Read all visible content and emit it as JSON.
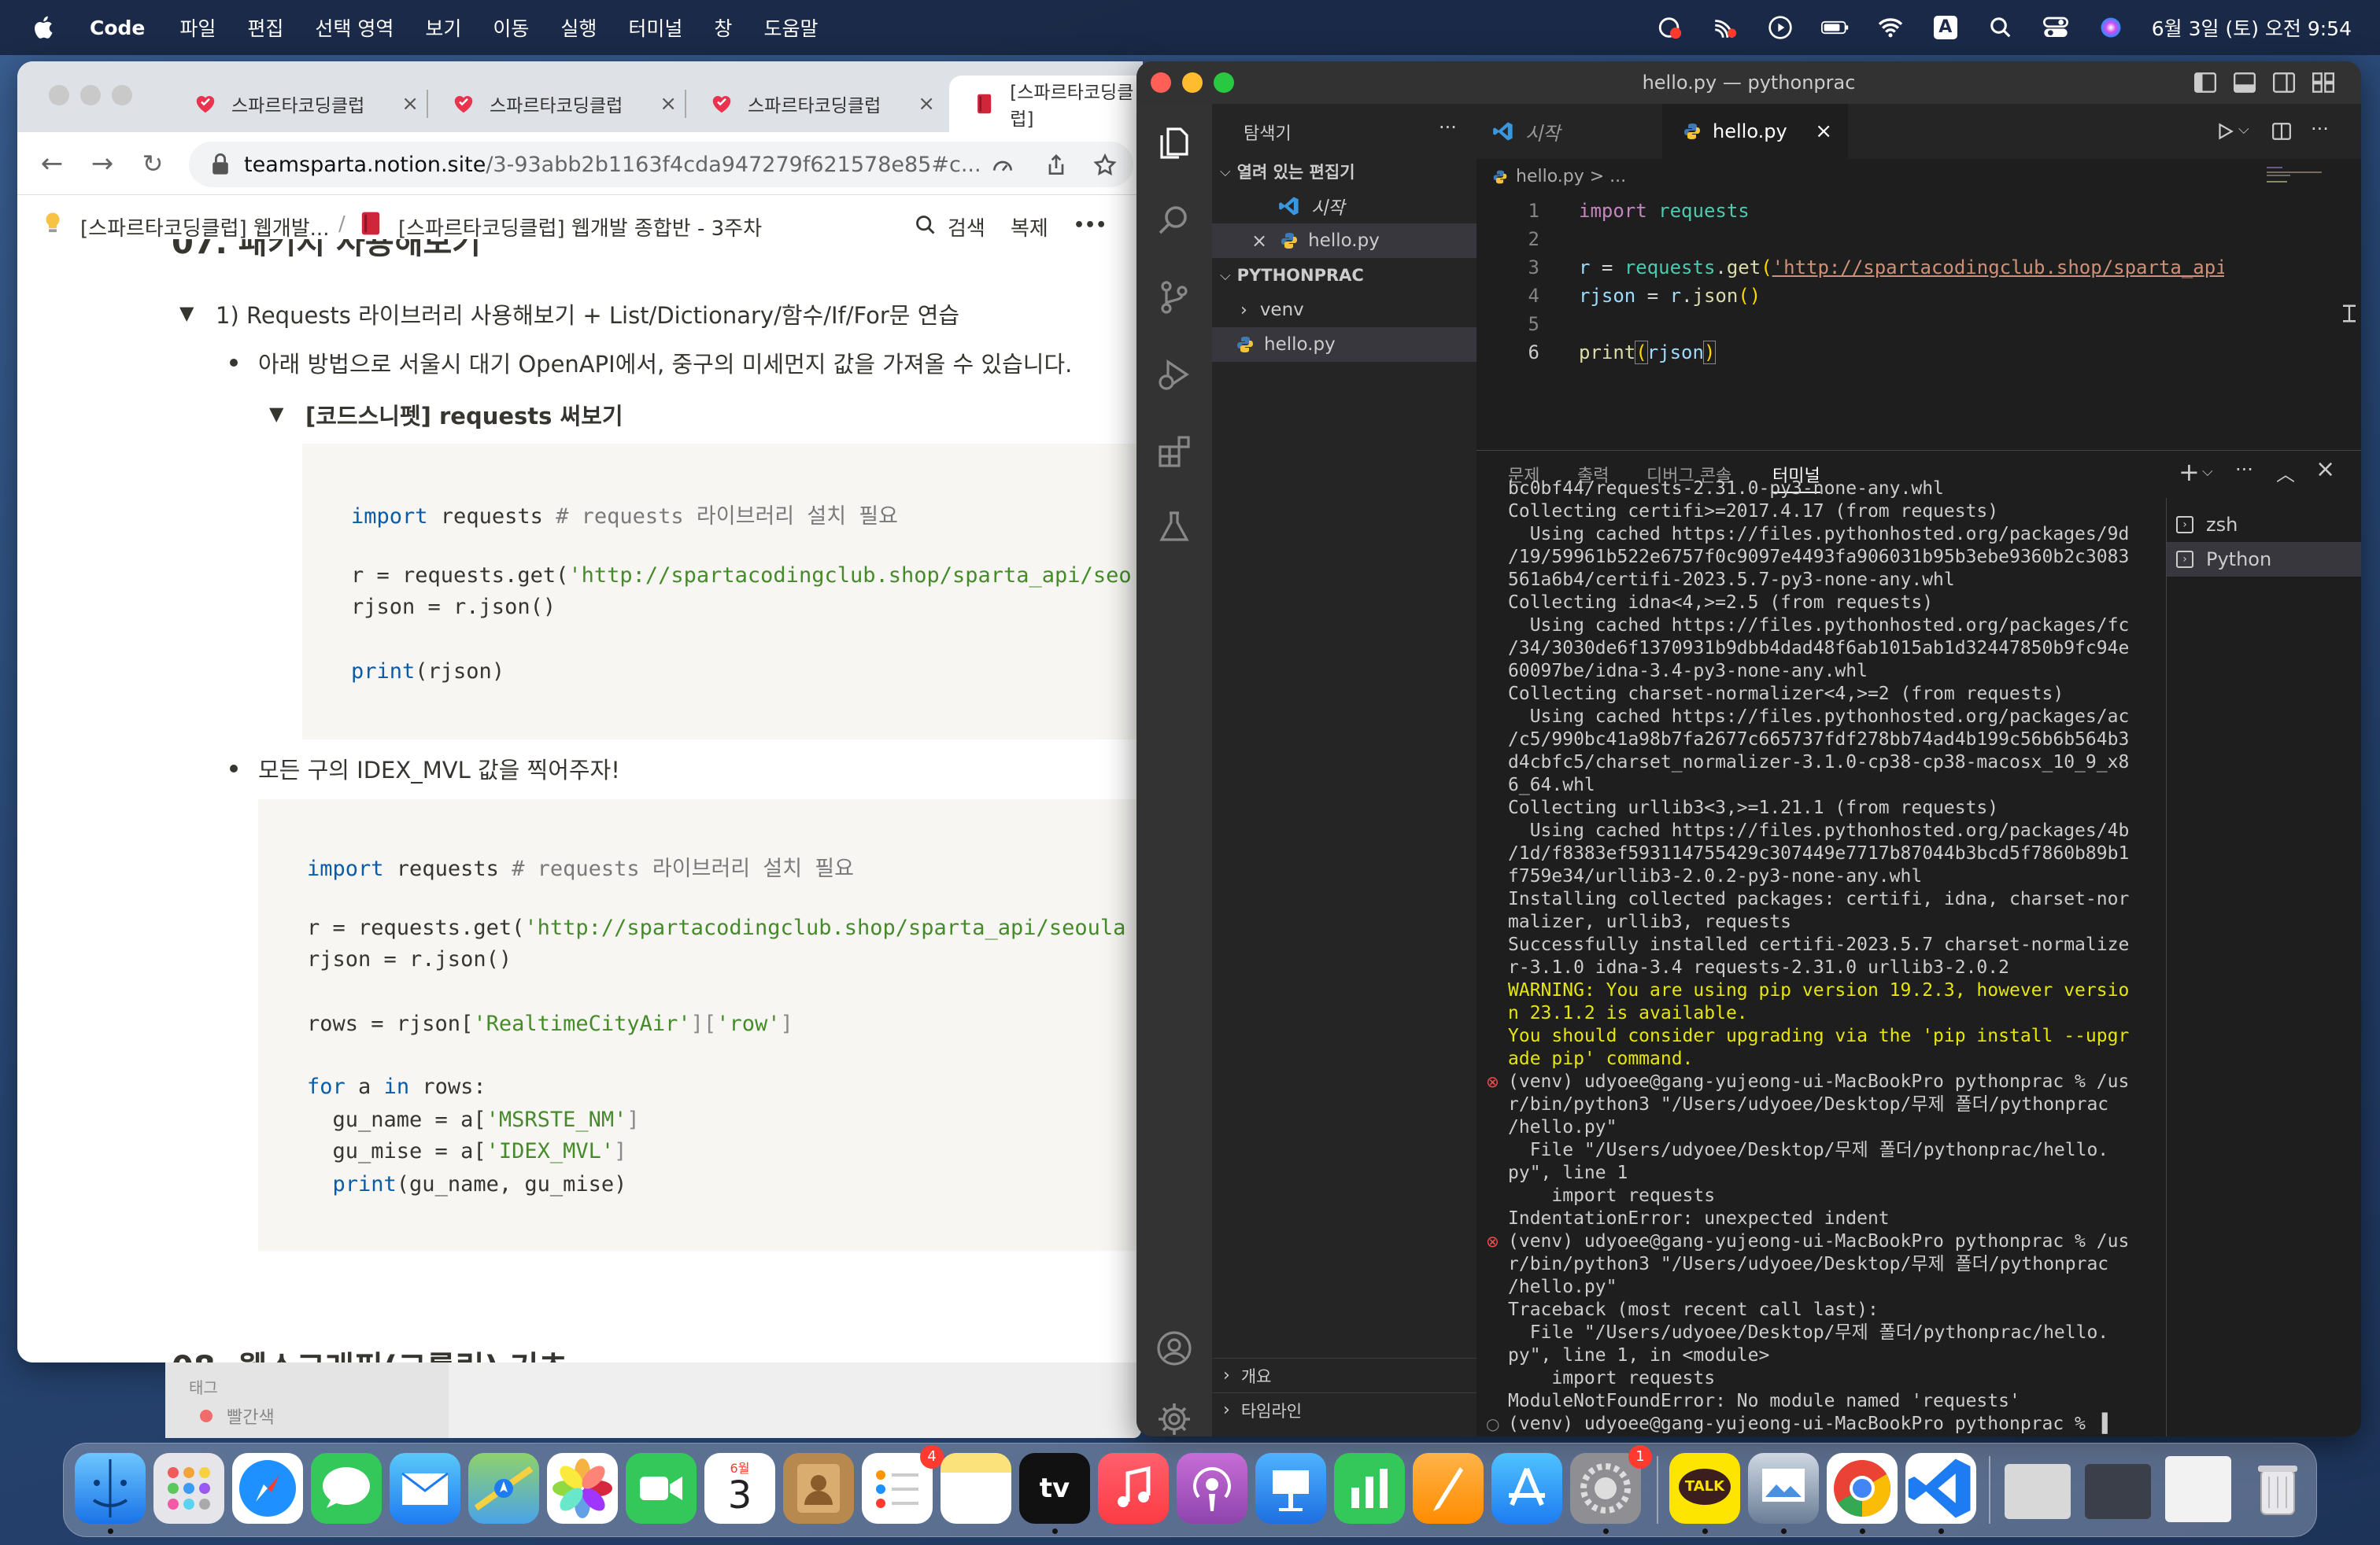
{
  "menubar": {
    "app": "Code",
    "items": [
      "파일",
      "편집",
      "선택 영역",
      "보기",
      "이동",
      "실행",
      "터미널",
      "창",
      "도움말"
    ],
    "clock": "6월 3일 (토) 오전 9:54",
    "input_indicator": "A"
  },
  "browser": {
    "tabs": [
      {
        "label": "스파르타코딩클럽"
      },
      {
        "label": "스파르타코딩클럽"
      },
      {
        "label": "스파르타코딩클럽"
      },
      {
        "label": "[스파르타코딩클럽]"
      }
    ],
    "url_host": "teamsparta.notion.site",
    "url_path": "/3-93abb2b1163f4cda947279f621578e85#c..."
  },
  "notion": {
    "breadcrumb_1": "[스파르타코딩클럽] 웹개발...",
    "breadcrumb_sep": "/",
    "breadcrumb_2": "[스파르타코딩클럽] 웹개발 종합반 - 3주차",
    "search_label": "검색",
    "duplicate_label": "복제",
    "more_label": "•••",
    "heading_cut": "07. 패키지 사용해보기",
    "toggle_1": "1) Requests 라이브러리 사용해보기 + List/Dictionary/함수/If/For문 연습",
    "bullet_1": "아래 방법으로 서울시 대기 OpenAPI에서, 중구의 미세먼지 값을 가져올 수 있습니다.",
    "toggle_2": "[코드스니펫] requests 써보기",
    "bullet_2": "모든 구의 IDEX_MVL 값을 찍어주자!",
    "heading_bottom_cut": "08. 웹스크래핑(크롤링) 기초",
    "code1": {
      "l1_kw": "import",
      "l1_mod": " requests ",
      "l1_cm": "# requests 라이브러리 설치 필요",
      "l2": "r = requests.get(",
      "l2_str": "'http://spartacodingclub.shop/sparta_api/seo",
      "l3": "rjson = r.json()",
      "l4_kw": "print",
      "l4": "(rjson)"
    },
    "code2": {
      "l1_kw": "import",
      "l1_mod": " requests ",
      "l1_cm": "# requests 라이브러리 설치 필요",
      "l2": "r = requests.get(",
      "l2_str": "'http://spartacodingclub.shop/sparta_api/seoula",
      "l3": "rjson = r.json()",
      "l4": "rows = rjson[",
      "l4_s1": "'RealtimeCityAir'",
      "l4_m": "][",
      "l4_s2": "'row'",
      "l4_e": "]",
      "l5_kw1": "for",
      "l5_a": " a ",
      "l5_kw2": "in",
      "l5_b": " rows:",
      "l6": "  gu_name = a[",
      "l6_s": "'MSRSTE_NM'",
      "l6_e": "]",
      "l7": "  gu_mise = a[",
      "l7_s": "'IDEX_MVL'",
      "l7_e": "]",
      "l8_kw": "  print",
      "l8": "(gu_name, gu_mise)"
    }
  },
  "bgwindow": {
    "tag_label": "태그",
    "tag_value": "빨간색"
  },
  "vscode": {
    "title": "hello.py — pythonprac",
    "sidebar": {
      "title": "탐색기",
      "more": "···",
      "open_editors": "열려 있는 편집기",
      "open_1": "시작",
      "open_2": "hello.py",
      "folder": "PYTHONPRAC",
      "venv": "venv",
      "file": "hello.py",
      "outline": "개요",
      "timeline": "타임라인"
    },
    "tabs": [
      {
        "label": "시작"
      },
      {
        "label": "hello.py"
      }
    ],
    "breadcrumb": "hello.py > ...",
    "code": {
      "l1_kw": "import",
      "l1_mod": "requests",
      "l3_a": "r",
      "l3_b": " = ",
      "l3_c": "requests",
      "l3_d": ".",
      "l3_e": "get",
      "l3_f": "(",
      "l3_g": "'http://spartacodingclub.shop/sparta_api/",
      "l4_a": "rjson",
      "l4_b": " = ",
      "l4_c": "r",
      "l4_d": ".",
      "l4_e": "json",
      "l4_f": "()",
      "l6_a": "print",
      "l6_b": "(",
      "l6_c": "rjson",
      "l6_d": ")"
    },
    "line_numbers": [
      "1",
      "2",
      "3",
      "4",
      "5",
      "6"
    ],
    "panel_tabs": [
      "문제",
      "출력",
      "디버그 콘솔",
      "터미널"
    ],
    "terminals": [
      "zsh",
      "Python"
    ],
    "terminal_lines": [
      "bc0bf44/requests-2.31.0-py3-none-any.whl",
      "Collecting certifi>=2017.4.17 (from requests)",
      "  Using cached https://files.pythonhosted.org/packages/9d",
      "/19/59961b522e6757f0c9097e4493fa906031b95b3ebe9360b2c3083",
      "561a6b4/certifi-2023.5.7-py3-none-any.whl",
      "Collecting idna<4,>=2.5 (from requests)",
      "  Using cached https://files.pythonhosted.org/packages/fc",
      "/34/3030de6f1370931b9dbb4dad48f6ab1015ab1d32447850b9fc94e",
      "60097be/idna-3.4-py3-none-any.whl",
      "Collecting charset-normalizer<4,>=2 (from requests)",
      "  Using cached https://files.pythonhosted.org/packages/ac",
      "/c5/990bc41a98b7fa2677c665737fdf278bb74ad4b199c56b6b564b3",
      "d4cbfc5/charset_normalizer-3.1.0-cp38-cp38-macosx_10_9_x8",
      "6_64.whl",
      "Collecting urllib3<3,>=1.21.1 (from requests)",
      "  Using cached https://files.pythonhosted.org/packages/4b",
      "/1d/f8383ef593114755429c307449e7717b87044b3bcd5f7860b89b1",
      "f759e34/urllib3-2.0.2-py3-none-any.whl",
      "Installing collected packages: certifi, idna, charset-nor",
      "malizer, urllib3, requests",
      "Successfully installed certifi-2023.5.7 charset-normalize",
      "r-3.1.0 idna-3.4 requests-2.31.0 urllib3-2.0.2",
      "WARNING: You are using pip version 19.2.3, however versio",
      "n 23.1.2 is available.",
      "You should consider upgrading via the 'pip install --upgr",
      "ade pip' command.",
      "(venv) udyoee@gang-yujeong-ui-MacBookPro pythonprac % /us",
      "r/bin/python3 \"/Users/udyoee/Desktop/무제 폴더/pythonprac",
      "/hello.py\"",
      "  File \"/Users/udyoee/Desktop/무제 폴더/pythonprac/hello.",
      "py\", line 1",
      "    import requests",
      "IndentationError: unexpected indent",
      "(venv) udyoee@gang-yujeong-ui-MacBookPro pythonprac % /us",
      "r/bin/python3 \"/Users/udyoee/Desktop/무제 폴더/pythonprac",
      "/hello.py\"",
      "Traceback (most recent call last):",
      "  File \"/Users/udyoee/Desktop/무제 폴더/pythonprac/hello.",
      "py\", line 1, in <module>",
      "    import requests",
      "ModuleNotFoundError: No module named 'requests'",
      "(venv) udyoee@gang-yujeong-ui-MacBookPro pythonprac % ▐"
    ]
  },
  "dock": {
    "calendar_month": "6월",
    "calendar_day": "3",
    "reminders_badge": "4",
    "settings_badge": "1",
    "tv_label": "tv",
    "kakao_label": "TALK"
  }
}
